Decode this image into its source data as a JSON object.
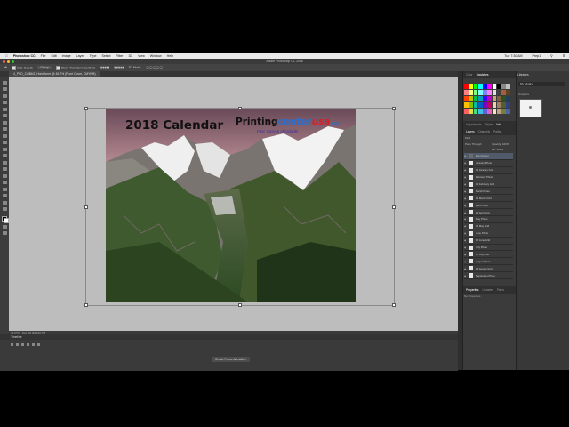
{
  "menubar": {
    "app": "Photoshop CC",
    "items": [
      "File",
      "Edit",
      "Image",
      "Layer",
      "Type",
      "Select",
      "Filter",
      "3D",
      "View",
      "Window",
      "Help"
    ],
    "clock": "Tue 7:30 AM",
    "user": "Prep1"
  },
  "window": {
    "title": "Adobe Photoshop CC 2018"
  },
  "options": {
    "auto_select": "Auto-Select:",
    "group": "Group",
    "show_transform": "Show Transform Controls",
    "mode_3d": "3D Mode:"
  },
  "document": {
    "tab": "4_PSD_CalBkG_HorizAmer @ 45.7% (Front Cover, CMYK/8)"
  },
  "calendar": {
    "title": "2018 Calendar",
    "brand_a": "Printing",
    "brand_b": "center",
    "brand_c": "usa",
    "brand_com": ".com",
    "tagline": "Fast, Easy & Affordable"
  },
  "status": {
    "zoom": "45.67%",
    "info": "Doc: 26.4M/196.7M"
  },
  "timeline": {
    "title": "Timeline",
    "create_button": "Create Frame Animation"
  },
  "right_panels": {
    "color_tabs": [
      "Color",
      "Swatches"
    ],
    "adjust_tabs": [
      "Adjustments",
      "Styles",
      "Info"
    ],
    "layers_tabs": [
      "Layers",
      "Channels",
      "Paths"
    ],
    "kind": "Kind",
    "blend": "Pass Through",
    "opacity": "Opacity: 100%",
    "fill": "Fill: 100%",
    "layers": [
      "Front Cover",
      "January Photo",
      "01 January Grid",
      "February Photo",
      "02 February Grid",
      "March Photo",
      "03 March Grid",
      "April Photo",
      "04 April Grid",
      "May Photo",
      "05 May Grid",
      "June Photo",
      "06 June Grid",
      "July Photo",
      "07 July Grid",
      "August Photo",
      "08 August Grid",
      "September Photo"
    ],
    "props_tabs": [
      "Properties",
      "Libraries",
      "Paths"
    ],
    "no_props": "No Properties"
  },
  "libraries": {
    "title": "Libraries",
    "select": "My Library",
    "section": "Graphics"
  },
  "colors": {
    "accent": "#2a6ecf",
    "brand_red": "#d3202a"
  }
}
